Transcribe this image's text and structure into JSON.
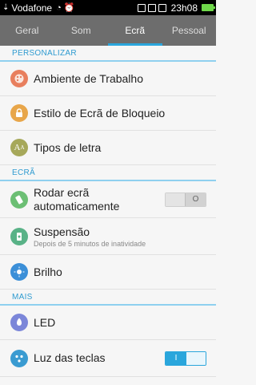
{
  "status": {
    "carrier": "Vodafone",
    "time": "23h08",
    "icons": [
      "usb-icon",
      "wifi-icon",
      "alarm-icon",
      "notification-icon",
      "mail-icon",
      "image-icon",
      "battery-icon"
    ]
  },
  "tabs": [
    {
      "label": "Geral"
    },
    {
      "label": "Som"
    },
    {
      "label": "Ecrã"
    },
    {
      "label": "Pessoal"
    }
  ],
  "active_tab": 2,
  "sections": {
    "personalizar": "PERSONALIZAR",
    "ecra": "ECRÃ",
    "mais": "MAIS"
  },
  "items": {
    "ambiente": {
      "title": "Ambiente de Trabalho",
      "icon": "palette-icon",
      "color": "#e87f5e"
    },
    "bloqueio": {
      "title": "Estilo de Ecrã de Bloqueio",
      "icon": "lock-icon",
      "color": "#e8a64a"
    },
    "tipos": {
      "title": "Tipos de letra",
      "icon": "font-icon",
      "color": "#a6a85a"
    },
    "rodar": {
      "title": "Rodar ecrã automaticamente",
      "icon": "rotate-icon",
      "color": "#6cbf74",
      "toggle": false,
      "toggle_label": "O"
    },
    "suspensao": {
      "title": "Suspensão",
      "subtitle": "Depois de 5 minutos de inatividade",
      "icon": "sleep-timer-icon",
      "color": "#59b287"
    },
    "brilho": {
      "title": "Brilho",
      "icon": "brightness-icon",
      "color": "#3b8fd8"
    },
    "led": {
      "title": "LED",
      "icon": "led-icon",
      "color": "#7b86d9"
    },
    "luz": {
      "title": "Luz das teclas",
      "icon": "key-light-icon",
      "color": "#3a9bd1",
      "toggle": true,
      "toggle_label": "I"
    }
  }
}
